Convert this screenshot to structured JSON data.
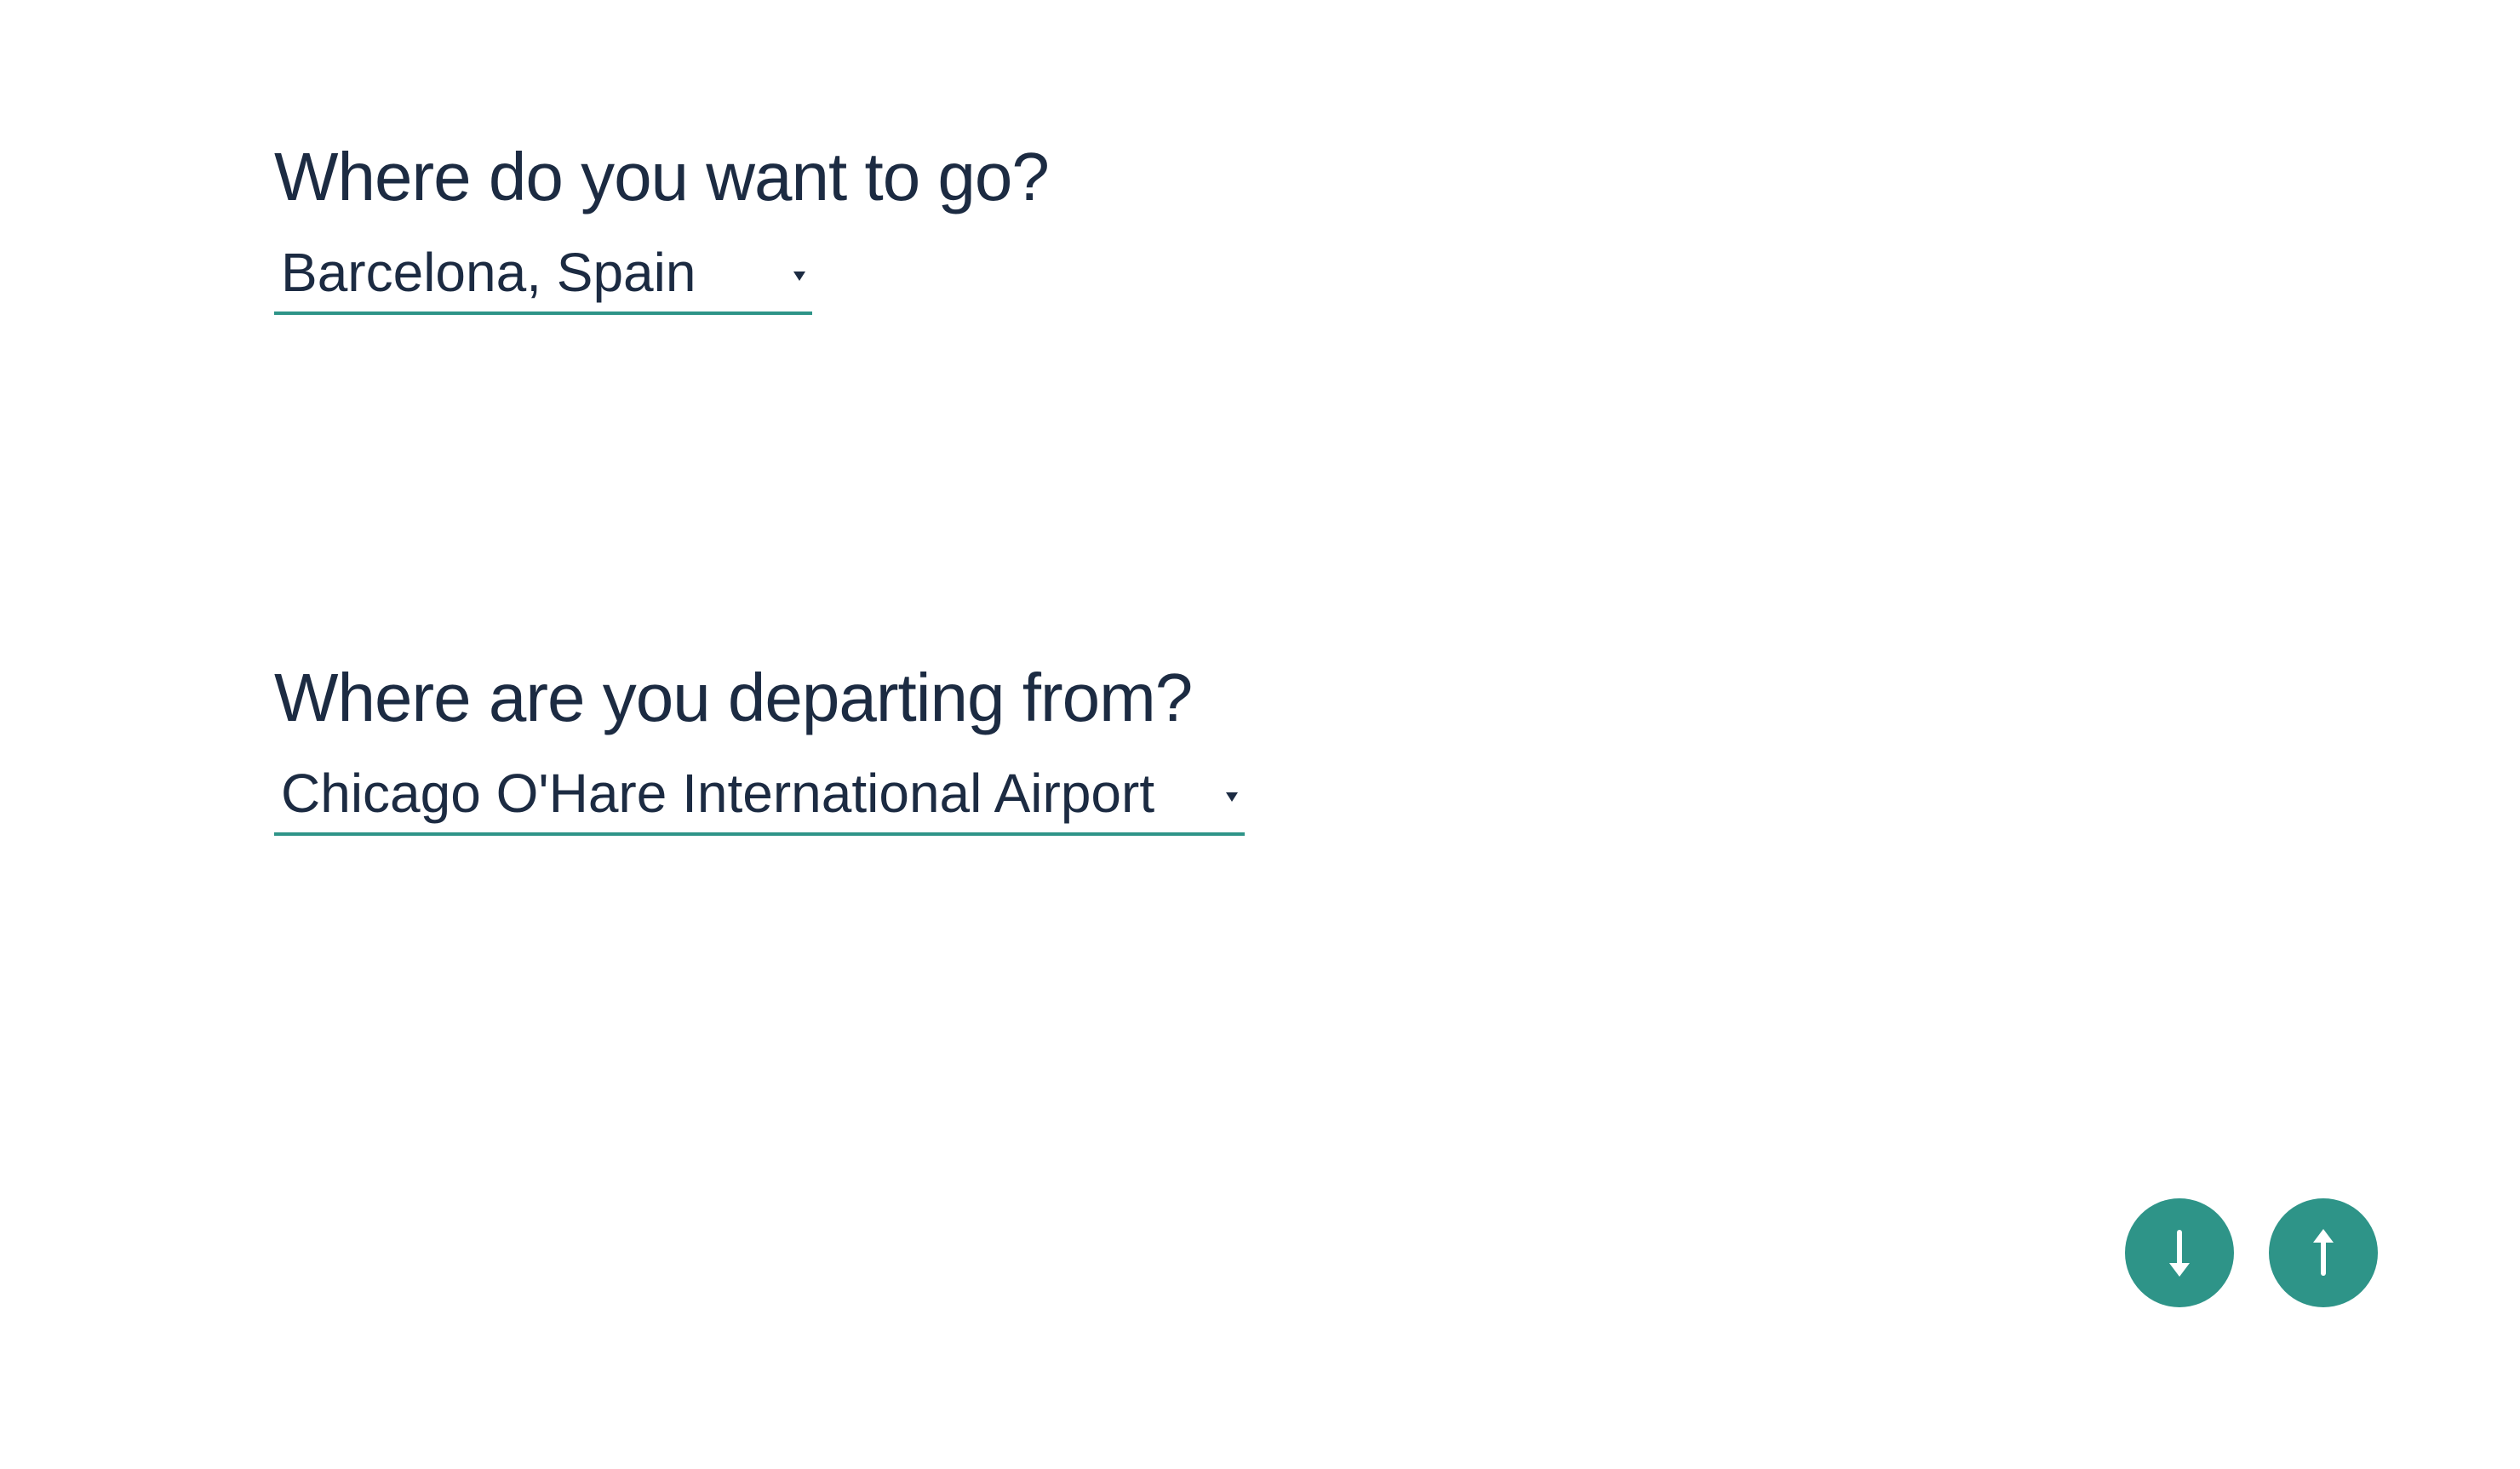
{
  "destination": {
    "question": "Where do you want to go?",
    "selected": "Barcelona, Spain"
  },
  "departure": {
    "question": "Where are you departing from?",
    "selected": "Chicago O'Hare International Airport"
  },
  "navigation": {
    "next_icon": "arrow-down-icon",
    "previous_icon": "arrow-up-icon"
  },
  "colors": {
    "accent": "#2e9488",
    "text": "#1c2b42",
    "background": "#ffffff"
  }
}
